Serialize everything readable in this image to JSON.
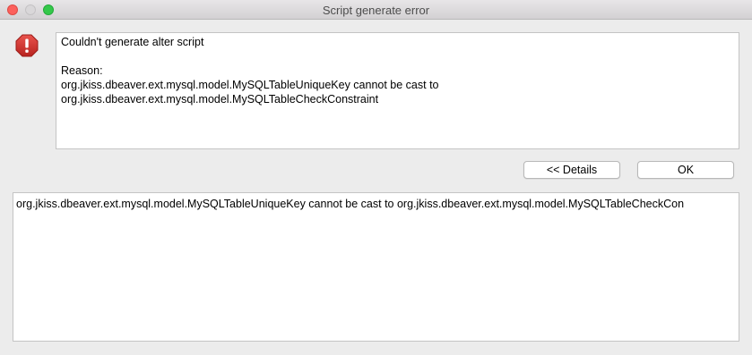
{
  "window": {
    "title": "Script generate error"
  },
  "message": {
    "headline": "Couldn't generate alter script",
    "reason_label": "Reason:",
    "reason_line1": "org.jkiss.dbeaver.ext.mysql.model.MySQLTableUniqueKey cannot be cast to",
    "reason_line2": "org.jkiss.dbeaver.ext.mysql.model.MySQLTableCheckConstraint"
  },
  "buttons": {
    "details_label": "<< Details",
    "ok_label": "OK"
  },
  "details": {
    "text": "org.jkiss.dbeaver.ext.mysql.model.MySQLTableUniqueKey cannot be cast to org.jkiss.dbeaver.ext.mysql.model.MySQLTableCheckCon"
  },
  "icons": {
    "error": "error-icon"
  },
  "colors": {
    "error_red": "#d73a35",
    "close_button": "#fc605c",
    "maximize_button": "#34c84a"
  }
}
